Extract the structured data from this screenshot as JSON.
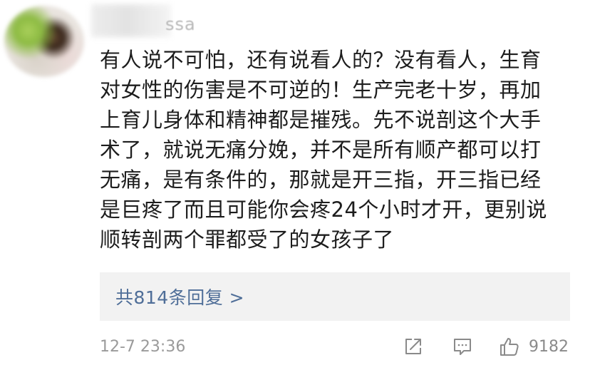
{
  "user": {
    "name_visible_tail": "ssa"
  },
  "comment": {
    "lines": [
      "有人说不可怕，还有说看人的？没有看人，生育",
      "对女性的伤害是不可逆的！生产完老十岁，再加",
      "上育儿身体和精神都是摧残。先不说剖这个大手",
      "术了，就说无痛分娩，并不是所有顺产都可以打",
      "无痛，是有条件的，那就是开三指，开三指已经",
      "是巨疼了而且可能你会疼24个小时才开，更别说",
      "顺转剖两个罪都受了的女孩子了"
    ]
  },
  "replies": {
    "label": "共814条回复 >"
  },
  "footer": {
    "timestamp": "12-7 23:36",
    "like_count": "9182",
    "icons": [
      "share-icon",
      "comment-icon",
      "like-icon"
    ]
  },
  "colors": {
    "text": "#1d1d1d",
    "link": "#4f6e98",
    "muted": "#9a9a9a",
    "reply_bg": "#f2f2f2"
  }
}
